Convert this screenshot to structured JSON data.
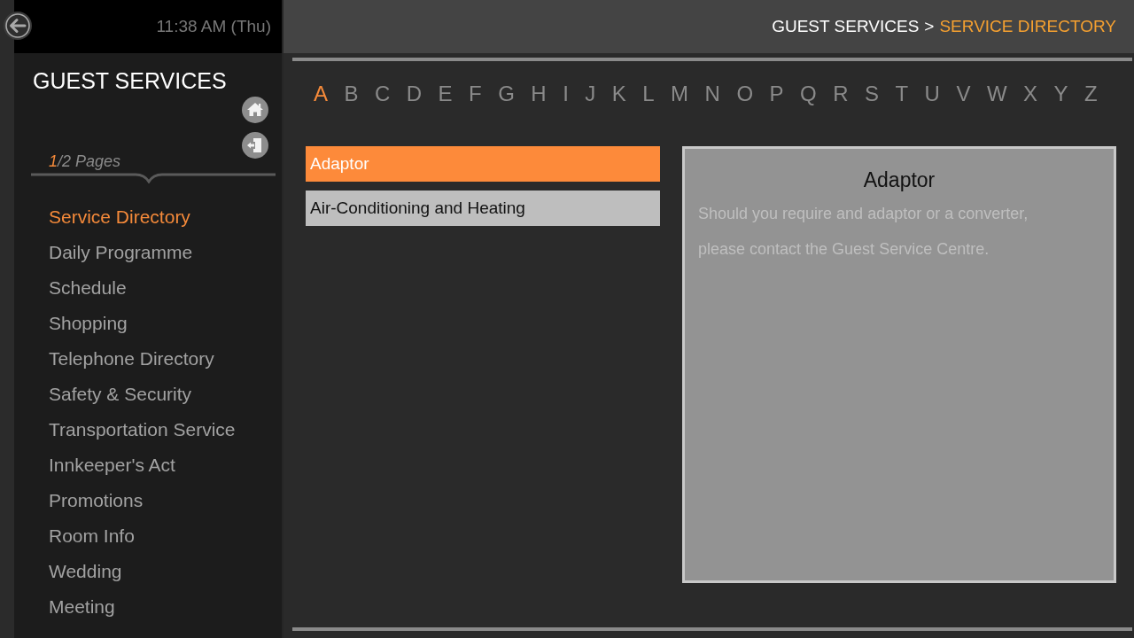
{
  "clock": "11:38 AM (Thu)",
  "breadcrumb": {
    "parent": "GUEST SERVICES",
    "separator": ">",
    "current": "SERVICE DIRECTORY"
  },
  "sidebar": {
    "title": "GUEST SERVICES",
    "pager": {
      "page": "1",
      "rest": "/2 Pages"
    },
    "items": [
      {
        "label": "Service Directory",
        "selected": true
      },
      {
        "label": "Daily Programme",
        "selected": false
      },
      {
        "label": "Schedule",
        "selected": false
      },
      {
        "label": "Shopping",
        "selected": false
      },
      {
        "label": "Telephone Directory",
        "selected": false
      },
      {
        "label": "Safety & Security",
        "selected": false
      },
      {
        "label": "Transportation Service",
        "selected": false
      },
      {
        "label": "Innkeeper's Act",
        "selected": false
      },
      {
        "label": "Promotions",
        "selected": false
      },
      {
        "label": "Room Info",
        "selected": false
      },
      {
        "label": "Wedding",
        "selected": false
      },
      {
        "label": "Meeting",
        "selected": false
      }
    ]
  },
  "alphabet": [
    {
      "letter": "A",
      "selected": true
    },
    {
      "letter": "B",
      "selected": false
    },
    {
      "letter": "C",
      "selected": false
    },
    {
      "letter": "D",
      "selected": false
    },
    {
      "letter": "E",
      "selected": false
    },
    {
      "letter": "F",
      "selected": false
    },
    {
      "letter": "G",
      "selected": false
    },
    {
      "letter": "H",
      "selected": false
    },
    {
      "letter": "I",
      "selected": false
    },
    {
      "letter": "J",
      "selected": false
    },
    {
      "letter": "K",
      "selected": false
    },
    {
      "letter": "L",
      "selected": false
    },
    {
      "letter": "M",
      "selected": false
    },
    {
      "letter": "N",
      "selected": false
    },
    {
      "letter": "O",
      "selected": false
    },
    {
      "letter": "P",
      "selected": false
    },
    {
      "letter": "Q",
      "selected": false
    },
    {
      "letter": "R",
      "selected": false
    },
    {
      "letter": "S",
      "selected": false
    },
    {
      "letter": "T",
      "selected": false
    },
    {
      "letter": "U",
      "selected": false
    },
    {
      "letter": "V",
      "selected": false
    },
    {
      "letter": "W",
      "selected": false
    },
    {
      "letter": "X",
      "selected": false
    },
    {
      "letter": "Y",
      "selected": false
    },
    {
      "letter": "Z",
      "selected": false
    }
  ],
  "entries": [
    {
      "label": "Adaptor",
      "selected": true
    },
    {
      "label": "Air-Conditioning and Heating",
      "selected": false
    }
  ],
  "detail": {
    "title": "Adaptor",
    "text": "Should you require and adaptor or a converter, please contact the Guest Service Centre."
  }
}
